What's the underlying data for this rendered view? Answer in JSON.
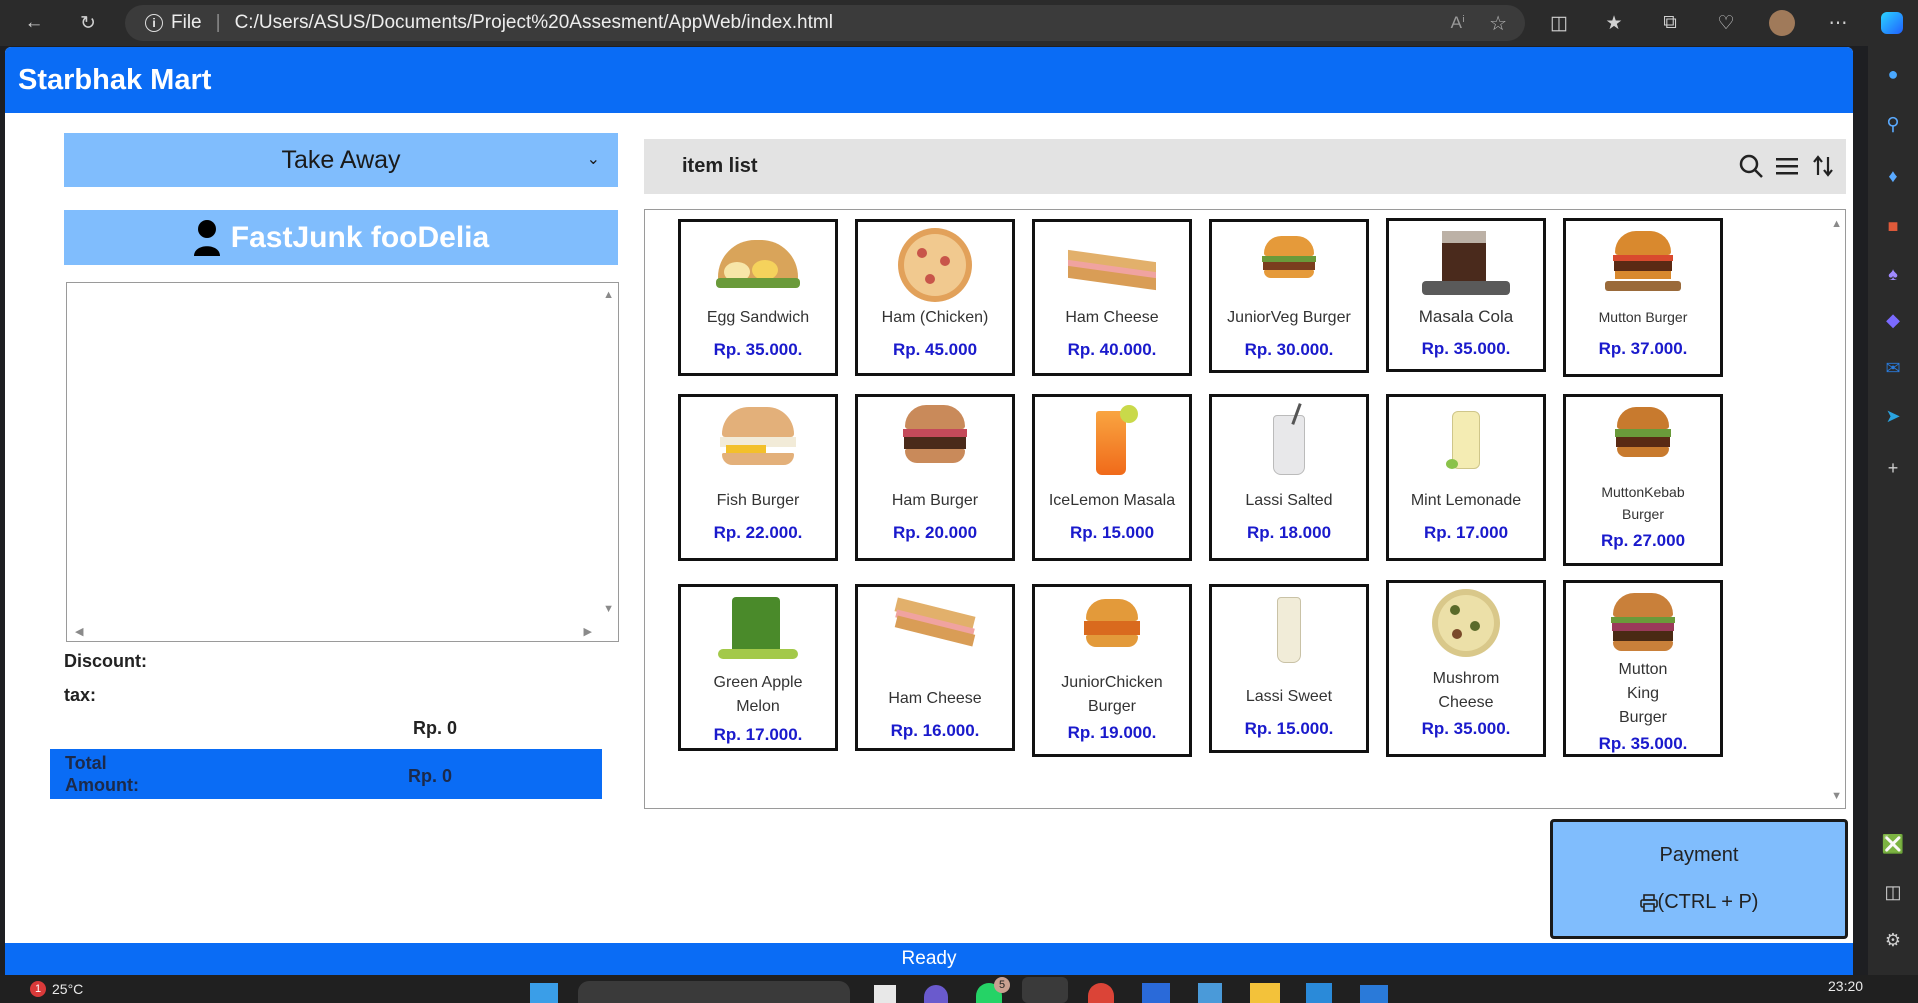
{
  "browser": {
    "protocol_label": "File",
    "url": "C:/Users/ASUS/Documents/Project%20Assesment/AppWeb/index.html"
  },
  "app": {
    "title": "Starbhak Mart",
    "order_type": "Take Away",
    "customer_name": "FastJunk fooDelia",
    "summary": {
      "discount_label": "Discount:",
      "tax_label": "tax:",
      "subtotal_value": "Rp. 0",
      "total_label": "Total Amount:",
      "total_value": "Rp. 0"
    },
    "item_list_title": "item list",
    "items": [
      {
        "name": "Egg Sandwich",
        "price": "Rp. 35.000.",
        "icon": "egg-sandwich-image"
      },
      {
        "name": "Ham (Chicken)",
        "price": "Rp. 45.000",
        "icon": "pizza-image"
      },
      {
        "name": "Ham Cheese",
        "price": "Rp. 40.000.",
        "icon": "sandwich-image"
      },
      {
        "name": "JuniorVeg Burger",
        "price": "Rp. 30.000.",
        "icon": "burger-image"
      },
      {
        "name": "Masala Cola",
        "price": "Rp. 35.000.",
        "icon": "cola-image"
      },
      {
        "name": "Mutton Burger",
        "price": "Rp. 37.000.",
        "icon": "burger-image"
      },
      {
        "name": "Fish Burger",
        "price": "Rp. 22.000.",
        "icon": "burger-image"
      },
      {
        "name": "Ham Burger",
        "price": "Rp. 20.000",
        "icon": "burger-image"
      },
      {
        "name": "IceLemon Masala",
        "price": "Rp. 15.000",
        "icon": "iced-drink-image"
      },
      {
        "name": "Lassi Salted",
        "price": "Rp. 18.000",
        "icon": "lassi-image"
      },
      {
        "name": "Mint Lemonade",
        "price": "Rp. 17.000",
        "icon": "lemonade-image"
      },
      {
        "name": "MuttonKebab Burger",
        "price": "Rp. 27.000",
        "icon": "burger-image"
      },
      {
        "name": "Green Apple Melon",
        "price": "Rp. 17.000.",
        "icon": "green-juice-image"
      },
      {
        "name": "Ham Cheese",
        "price": "Rp. 16.000.",
        "icon": "sandwich-image"
      },
      {
        "name": "JuniorChicken Burger",
        "price": "Rp. 19.000.",
        "icon": "burger-image"
      },
      {
        "name": "Lassi Sweet",
        "price": "Rp. 15.000.",
        "icon": "lassi-image"
      },
      {
        "name": "Mushrom Cheese",
        "price": "Rp. 35.000.",
        "icon": "pizza-image"
      },
      {
        "name": "Mutton King Burger",
        "price": "Rp. 35.000.",
        "icon": "burger-image"
      }
    ],
    "payment": {
      "label": "Payment",
      "shortcut": "(CTRL + P)"
    },
    "status": "Ready"
  },
  "taskbar": {
    "weather": "25°C",
    "weather_badge": "1",
    "app_badge": "5",
    "time": "23:20"
  },
  "colors": {
    "header_blue": "#0a6cf5",
    "panel_light_blue": "#80bdfd",
    "price_blue": "#1a1acc"
  }
}
